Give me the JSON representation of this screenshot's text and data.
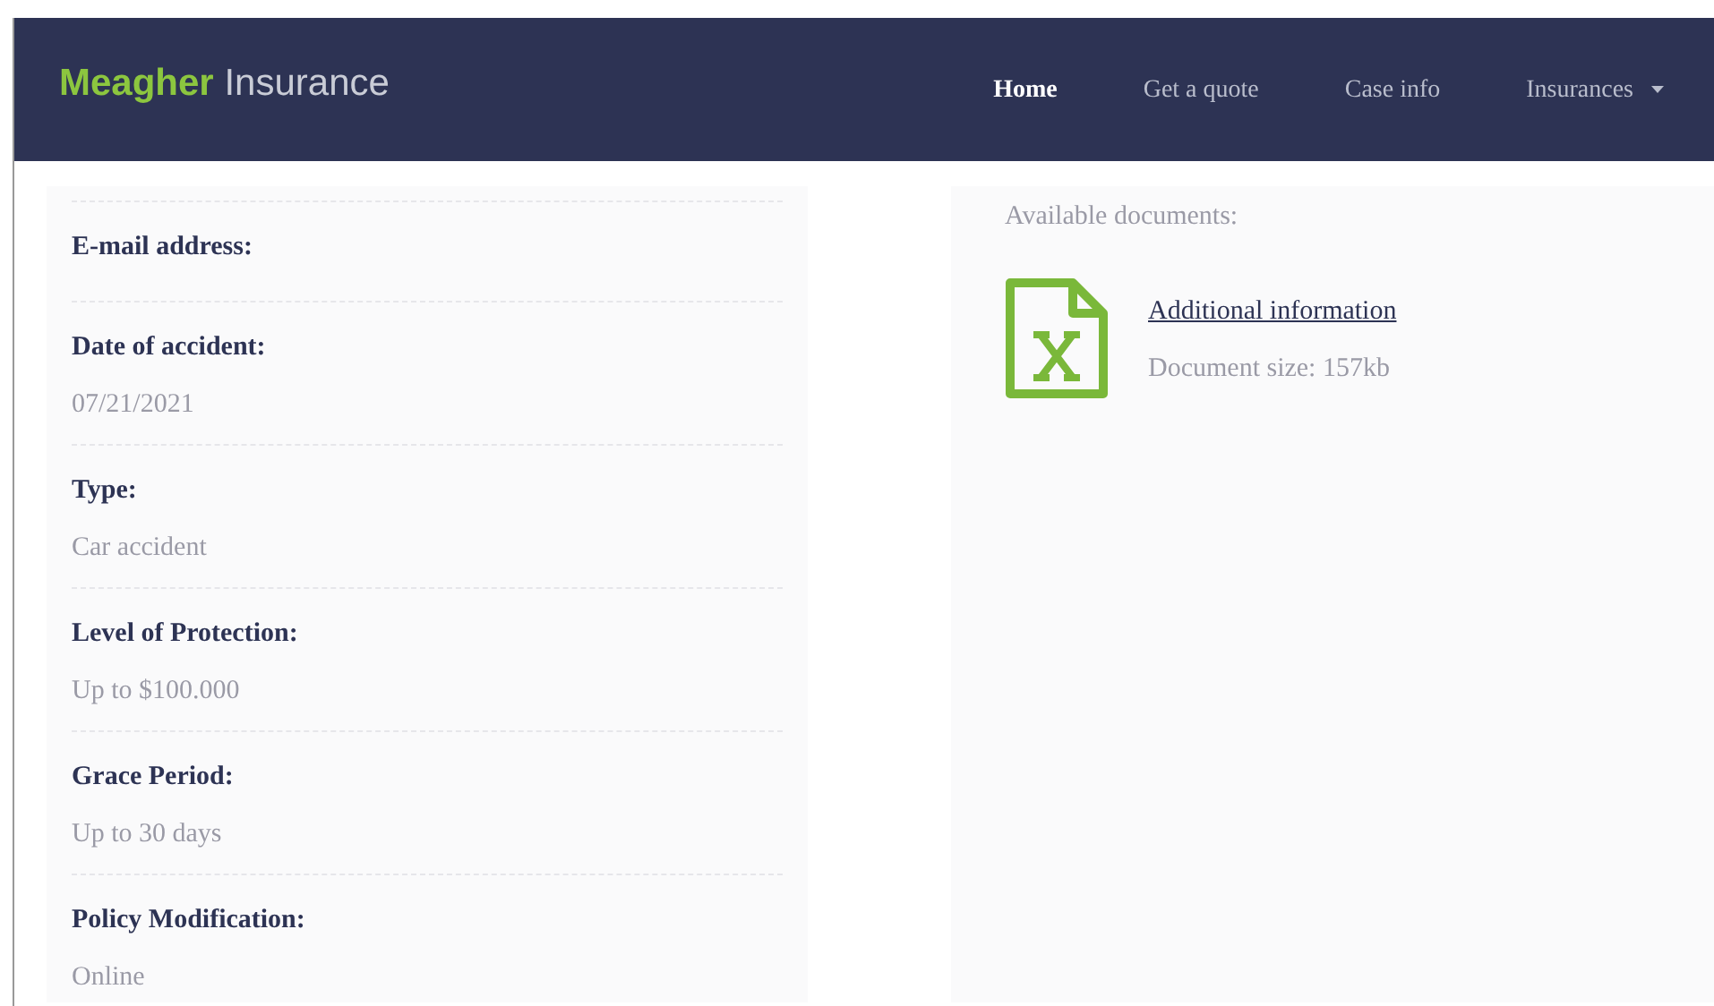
{
  "brand": {
    "bold": "Meagher",
    "rest": "Insurance"
  },
  "nav": [
    {
      "label": "Home",
      "selected": true
    },
    {
      "label": "Get a quote",
      "selected": false
    },
    {
      "label": "Case info",
      "selected": false
    },
    {
      "label": "Insurances",
      "selected": false,
      "dropdown": true
    }
  ],
  "details": [
    {
      "label": "E-mail address:"
    },
    {
      "label": "Date of accident:",
      "value": "07/21/2021"
    },
    {
      "label": "Type:",
      "value": "Car accident"
    },
    {
      "label": "Level of Protection:",
      "value": "Up to $100.000"
    },
    {
      "label": "Grace Period:",
      "value": "Up to 30 days"
    },
    {
      "label": "Policy Modification:",
      "value": "Online"
    }
  ],
  "documents": {
    "heading": "Available documents:",
    "items": [
      {
        "kind": "spreadsheet",
        "title": "Additional information",
        "size": "Document size: 157kb"
      }
    ]
  }
}
